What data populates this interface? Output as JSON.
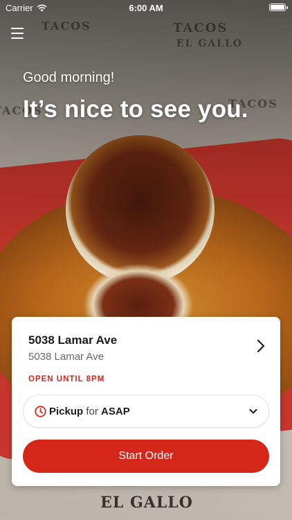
{
  "status_bar": {
    "carrier": "Carrier",
    "time": "6:00 AM",
    "battery_level": 1.0
  },
  "header": {
    "menu_icon": "hamburger-menu-icon",
    "greeting": "Good morning!",
    "headline": "It’s nice to see you."
  },
  "location": {
    "name": "5038 Lamar Ave",
    "address": "5038 Lamar Ave",
    "hours": "OPEN UNTIL 8PM"
  },
  "order": {
    "type": "Pickup",
    "connector": "for",
    "time": "ASAP",
    "icon": "clock-icon"
  },
  "actions": {
    "start_order": "Start Order"
  },
  "background": {
    "logo_text": "EL GALLO"
  },
  "colors": {
    "accent": "#d4271a",
    "hours_text": "#d0281a"
  }
}
